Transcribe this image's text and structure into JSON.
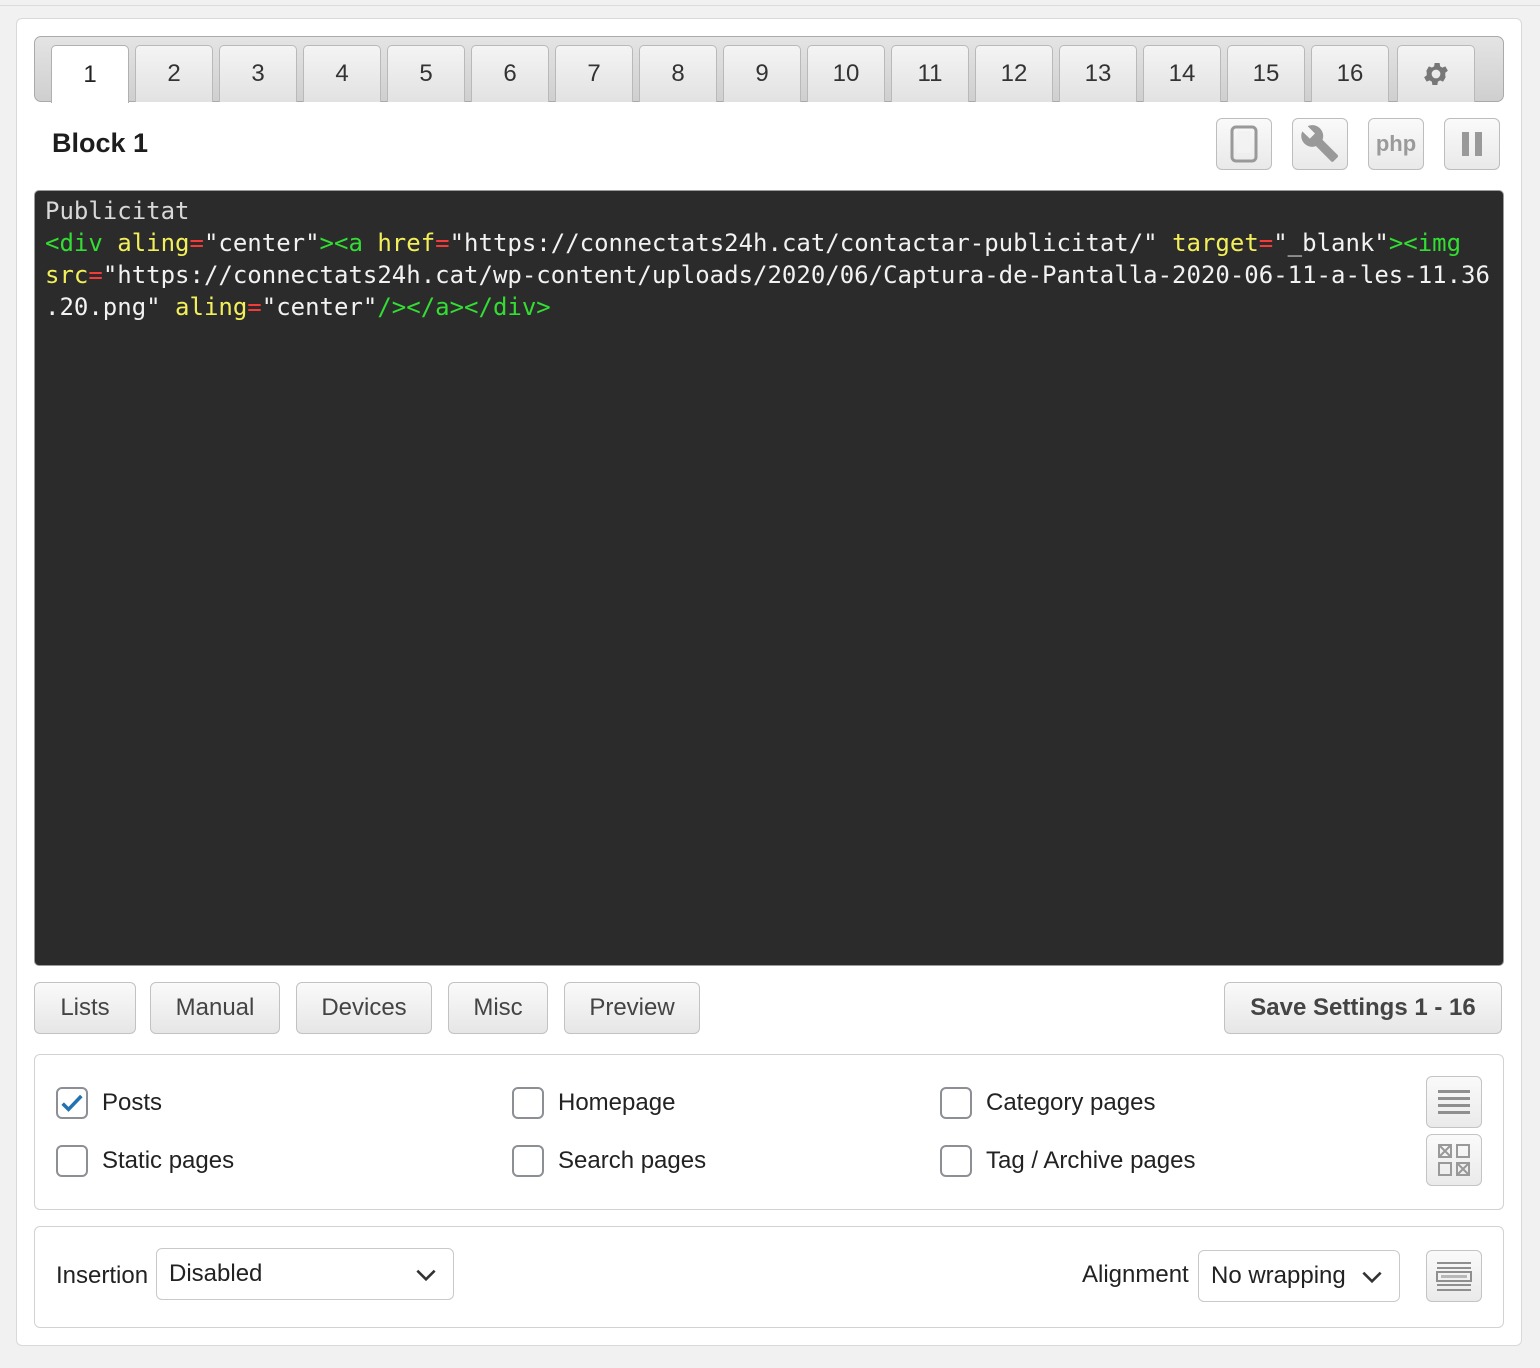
{
  "tabs": [
    {
      "label": "1",
      "active": true
    },
    {
      "label": "2"
    },
    {
      "label": "3"
    },
    {
      "label": "4"
    },
    {
      "label": "5"
    },
    {
      "label": "6"
    },
    {
      "label": "7"
    },
    {
      "label": "8"
    },
    {
      "label": "9"
    },
    {
      "label": "10"
    },
    {
      "label": "11"
    },
    {
      "label": "12"
    },
    {
      "label": "13"
    },
    {
      "label": "14"
    },
    {
      "label": "15"
    },
    {
      "label": "16"
    }
  ],
  "settings_tab_icon": "gear-icon",
  "block": {
    "title": "Block 1"
  },
  "toolbar": {
    "device_icon": "tablet-icon",
    "tools_icon": "wrench-icon",
    "php_label": "php",
    "pause_icon": "pause-icon"
  },
  "editor": {
    "line1": "Publicitat",
    "line2_tag_open": "<div",
    "line2_attr1": "aling",
    "eq": "=",
    "line2_val1": "\"center\"",
    "line2_tag_a": "><a",
    "line2_attr2": "href",
    "line2_val2": "\"https://connectats24h.cat/contactar-publicitat/\"",
    "line2_attr3": "target",
    "line2_val3": "\"_blank\"",
    "line2_tag_img": "><img",
    "line3_attr": "src",
    "line3_val": "\"https://connectats24h.cat/wp-content/uploads/2020/06/Captura-de-Pantalla-2020-06-11-a-les-11.36",
    "line4_val_end": ".20.png\"",
    "line4_attr": "aling",
    "line4_val": "\"center\"",
    "line4_close": "/></a></div>"
  },
  "buttons": {
    "lists": "Lists",
    "manual": "Manual",
    "devices": "Devices",
    "misc": "Misc",
    "preview": "Preview",
    "save": "Save Settings 1 - 16"
  },
  "checkboxes": [
    {
      "label": "Posts",
      "checked": true
    },
    {
      "label": "Homepage",
      "checked": false
    },
    {
      "label": "Category pages",
      "checked": false
    },
    {
      "label": "Static pages",
      "checked": false
    },
    {
      "label": "Search pages",
      "checked": false
    },
    {
      "label": "Tag / Archive pages",
      "checked": false
    }
  ],
  "checkbox_side_icons": [
    "list-icon",
    "grid-toggle-icon"
  ],
  "insertion": {
    "label": "Insertion",
    "value": "Disabled"
  },
  "alignment": {
    "label": "Alignment",
    "value": "No wrapping",
    "icon": "alignment-preview-icon"
  },
  "colors": {
    "editor_bg": "#2b2b2b",
    "tag": "#33dd33",
    "attr": "#f2ef5a",
    "equals": "#f53a3a",
    "check": "#2271b1"
  }
}
